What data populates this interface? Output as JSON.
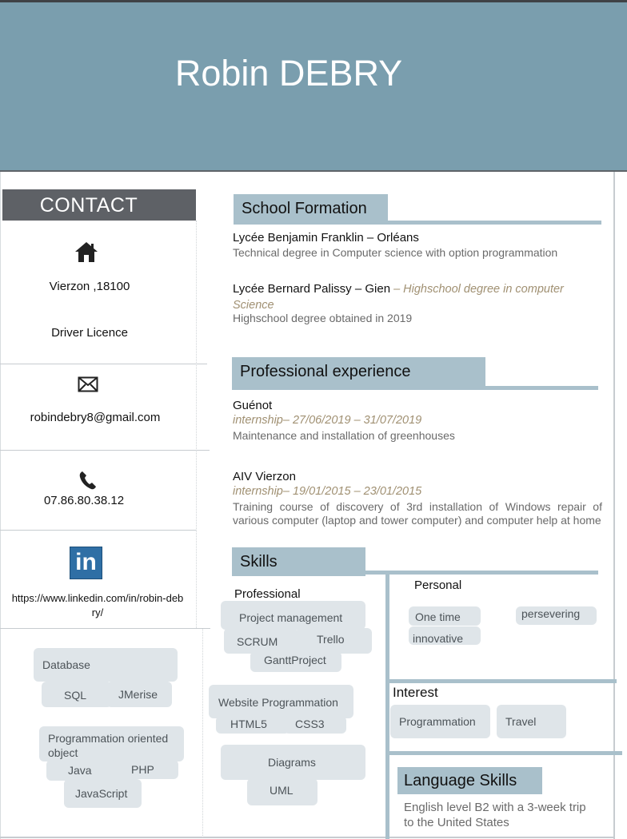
{
  "header": {
    "name": "Robin DEBRY"
  },
  "contact": {
    "title": "CONTACT",
    "address": "Vierzon ,18100",
    "licence": "Driver Licence",
    "email": "robindebry8@gmail.com",
    "phone": "07.86.80.38.12",
    "linkedin_logo": "in",
    "linkedin_url_line1": "https://www.linkedin.com/in/robin-deb",
    "linkedin_url_line2": "ry/"
  },
  "tech_skills": {
    "database": "Database",
    "sql": "SQL",
    "jmerise": "JMerise",
    "poo_line1": "Programmation oriented",
    "poo_line2": "object",
    "java": "Java",
    "php": "PHP",
    "javascript": "JavaScript"
  },
  "school": {
    "title": "School Formation",
    "entries": [
      {
        "title": "Lycée Benjamin Franklin – Orléans",
        "desc": "Technical degree in Computer science with option programmation"
      },
      {
        "title": "Lycée Bernard Palissy – Gien",
        "italic_inline": " – Highschool degree in computer",
        "italic_line2": "Science",
        "desc": "Highschool degree obtained in  2019"
      }
    ]
  },
  "experience": {
    "title": "Professional experience",
    "entries": [
      {
        "company": "Guénot",
        "dates": "internship– 27/06/2019 – 31/07/2019",
        "desc": "Maintenance and installation of greenhouses"
      },
      {
        "company": "AIV Vierzon",
        "dates": "internship– 19/01/2015 – 23/01/2015",
        "desc": "Training course of discovery of 3rd installation of Windows repair of various computer (laptop and tower computer) and computer help at home"
      }
    ]
  },
  "skills": {
    "title": "Skills",
    "professional_label": "Professional",
    "project_management": "Project management",
    "scrum": "SCRUM",
    "trello": "Trello",
    "ganttproject": "GanttProject",
    "web_prog": "Website Programmation",
    "html5": "HTML5",
    "css3": "CSS3",
    "diagrams": "Diagrams",
    "uml": "UML",
    "personal_label": "Personal",
    "one_time": "One time",
    "innovative": "innovative",
    "persevering": "persevering"
  },
  "interest": {
    "title": "Interest",
    "items": [
      "Programmation",
      "Travel"
    ]
  },
  "language": {
    "title": "Language Skills",
    "line1": "English level B2 with a 3-week trip",
    "line2": "to the United States"
  },
  "colors": {
    "header_bg": "#7a9eae",
    "contact_header_bg": "#5e6166",
    "section_accent": "#a9c0cb",
    "tag_bg": "#dfe5e9",
    "italic_accent": "#a09072"
  },
  "icons": {
    "home": "home-icon",
    "mail": "envelope-icon",
    "phone": "phone-icon",
    "linkedin": "linkedin-icon"
  }
}
